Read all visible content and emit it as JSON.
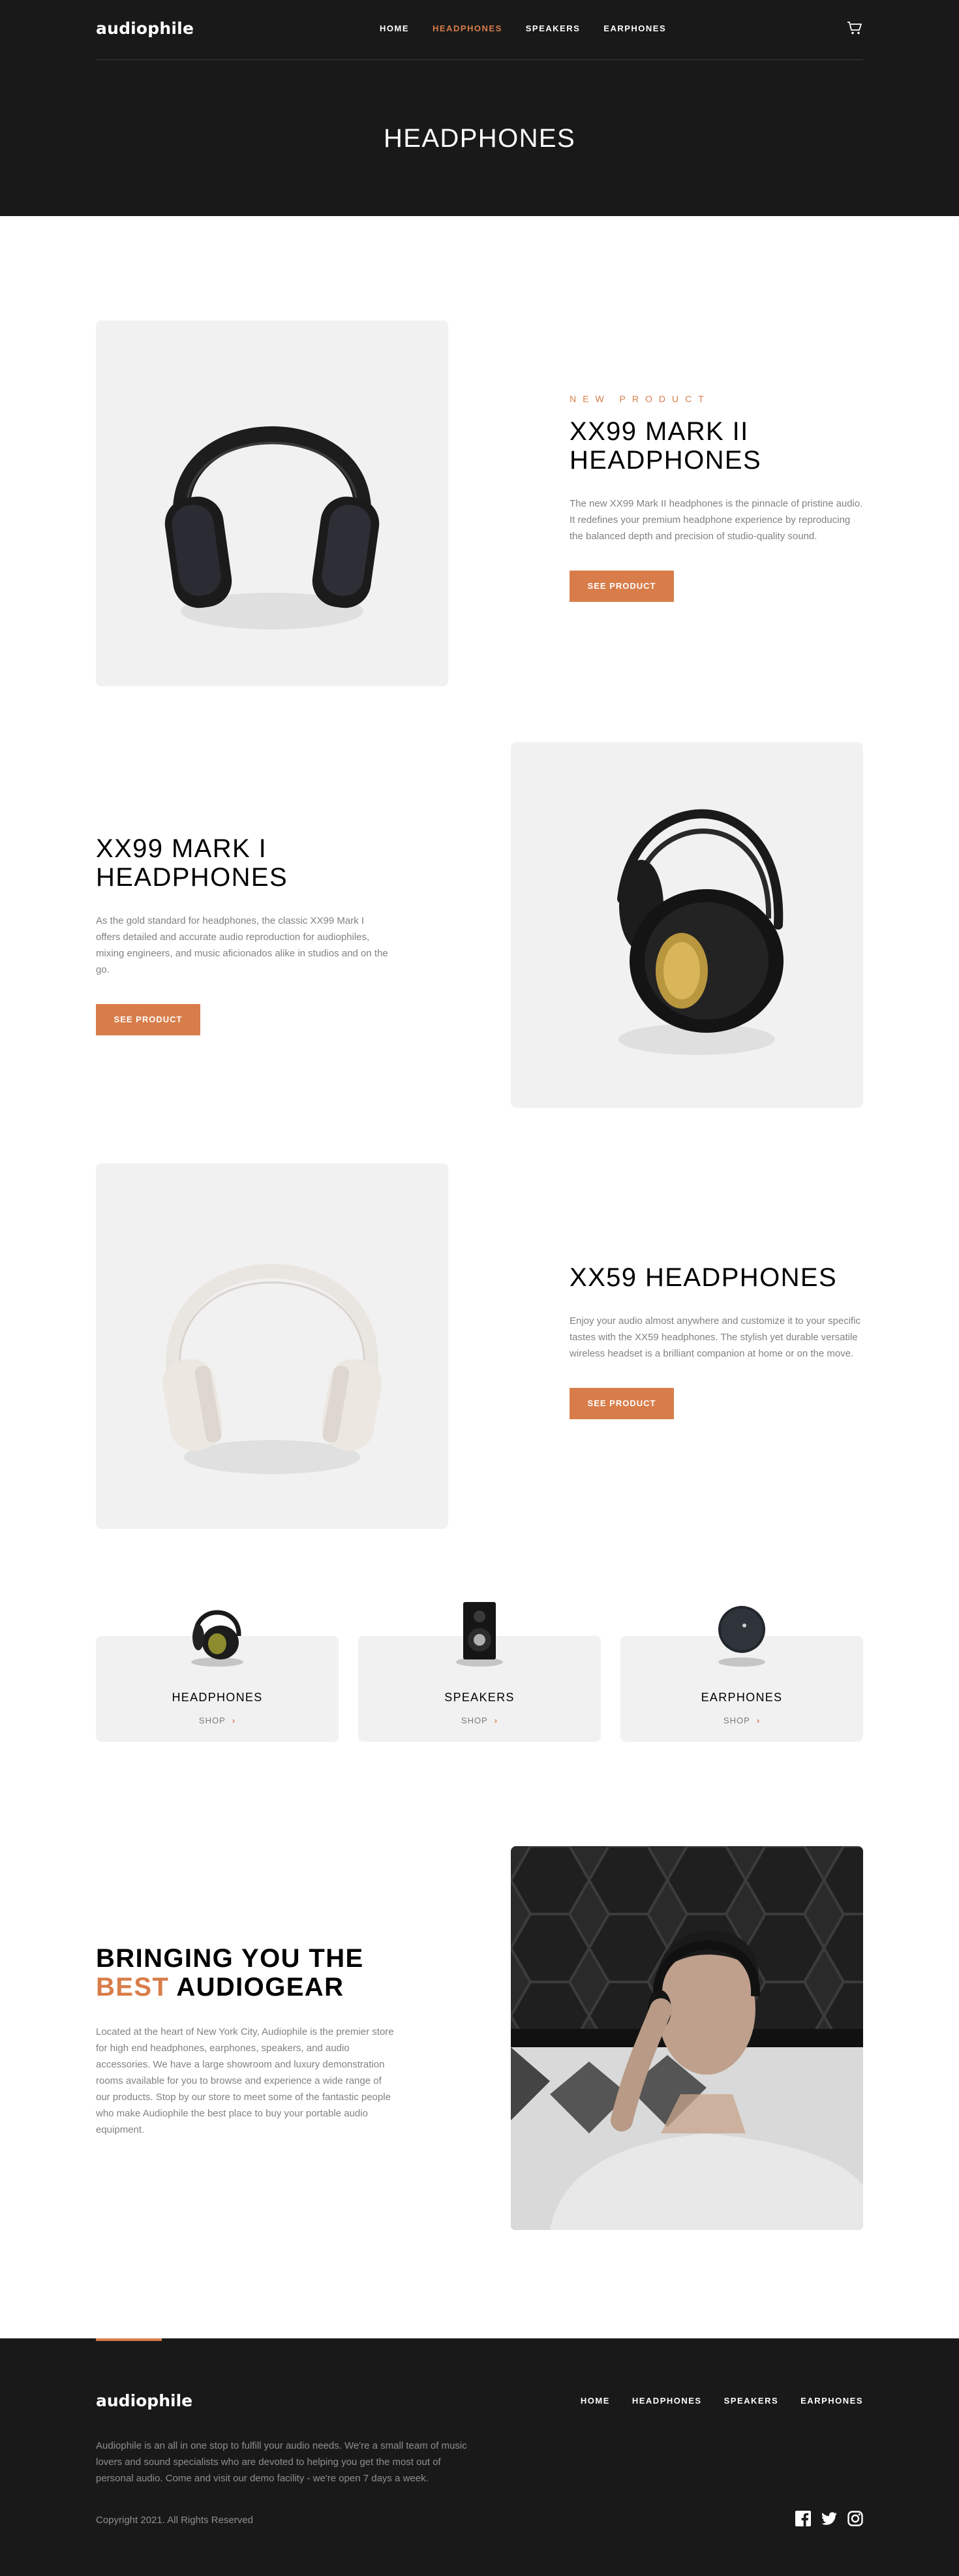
{
  "header": {
    "logo": "audiophile",
    "nav": [
      "HOME",
      "HEADPHONES",
      "SPEAKERS",
      "EARPHONES"
    ],
    "active_nav": "HEADPHONES",
    "cart_icon": "cart-icon",
    "page_title": "HEADPHONES"
  },
  "products": [
    {
      "overline": "NEW PRODUCT",
      "name": "XX99 MARK II HEADPHONES",
      "description": "The new XX99 Mark II headphones is the pinnacle of pristine audio. It redefines your premium headphone experience by reproducing the balanced depth and precision of studio-quality sound.",
      "button": "SEE PRODUCT"
    },
    {
      "name": "XX99 MARK I HEADPHONES",
      "description": "As the gold standard for headphones, the classic XX99 Mark I offers detailed and accurate audio reproduction for audiophiles, mixing engineers, and music aficionados alike in studios and on the go.",
      "button": "SEE PRODUCT"
    },
    {
      "name": "XX59 HEADPHONES",
      "description": "Enjoy your audio almost anywhere and customize it to your specific tastes with the XX59 headphones. The stylish yet durable versatile wireless headset is a brilliant companion at home or on the move.",
      "button": "SEE PRODUCT"
    }
  ],
  "categories": [
    {
      "name": "HEADPHONES",
      "shop": "SHOP"
    },
    {
      "name": "SPEAKERS",
      "shop": "SHOP"
    },
    {
      "name": "EARPHONES",
      "shop": "SHOP"
    }
  ],
  "about": {
    "title_prefix": "BRINGING YOU THE",
    "title_accent": "BEST",
    "title_suffix": "AUDIOGEAR",
    "description": "Located at the heart of New York City, Audiophile is the premier store for high end headphones, earphones, speakers, and audio accessories. We have a large showroom and luxury demonstration rooms available for you to browse and experience a wide range of our products. Stop by our store to meet some of the fantastic people who make Audiophile the best place to buy your portable audio equipment."
  },
  "footer": {
    "logo": "audiophile",
    "nav": [
      "HOME",
      "HEADPHONES",
      "SPEAKERS",
      "EARPHONES"
    ],
    "description": "Audiophile is an all in one stop to fulfill your audio needs. We're a small team of music lovers and sound specialists who are devoted to helping you get the most out of personal audio. Come and visit our demo facility - we're open 7 days a week.",
    "copyright": "Copyright 2021. All Rights Reserved",
    "socials": [
      "facebook-icon",
      "twitter-icon",
      "instagram-icon"
    ]
  },
  "colors": {
    "accent": "#d87d4a",
    "dark": "#191919",
    "light_gray": "#f1f1f1"
  }
}
